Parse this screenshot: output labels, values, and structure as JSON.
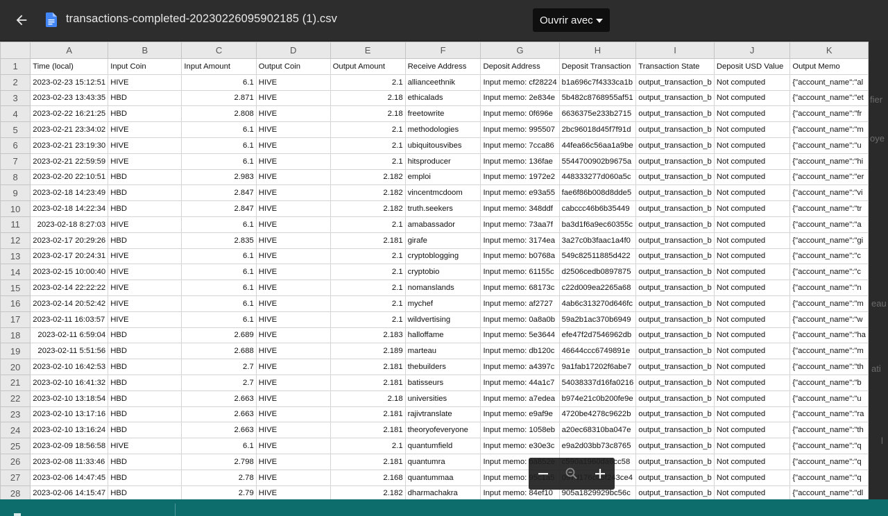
{
  "viewer": {
    "filename": "transactions-completed-20230226095902185 (1).csv",
    "open_with_label": "Ouvrir avec",
    "back_icon": "arrow-left-icon",
    "file_icon": "google-docs-icon"
  },
  "background_text": [
    "fier",
    "oye",
    "eau",
    "ati",
    "l"
  ],
  "sheet": {
    "columns": [
      "A",
      "B",
      "C",
      "D",
      "E",
      "F",
      "G",
      "H",
      "I",
      "J",
      "K"
    ],
    "headers": [
      "Time (local)",
      "Input Coin",
      "Input Amount",
      "Output Coin",
      "Output Amount",
      "Receive Address",
      "Deposit Address",
      "Deposit Transaction",
      "Transaction State",
      "Deposit USD Value",
      "Output Memo"
    ],
    "rows": [
      [
        "2023-02-23 15:12:51",
        "HIVE",
        "6.1",
        "HIVE",
        "2.1",
        "allianceethnik",
        "Input memo: cf28224",
        "b1a696c7f4333ca1b",
        "output_transaction_b",
        "Not computed",
        "{\"account_name\":\"al"
      ],
      [
        "2023-02-23 13:43:35",
        "HBD",
        "2.871",
        "HIVE",
        "2.18",
        "ethicalads",
        "Input memo: 2e834e",
        "5b482c8768955af51",
        "output_transaction_b",
        "Not computed",
        "{\"account_name\":\"et"
      ],
      [
        "2023-02-22 16:21:25",
        "HBD",
        "2.808",
        "HIVE",
        "2.18",
        "freetowrite",
        "Input memo: 0f696e",
        "6636375e233b2715",
        "output_transaction_b",
        "Not computed",
        "{\"account_name\":\"fr"
      ],
      [
        "2023-02-21 23:34:02",
        "HIVE",
        "6.1",
        "HIVE",
        "2.1",
        "methodologies",
        "Input memo: 995507",
        "2bc96018d45f7f91d",
        "output_transaction_b",
        "Not computed",
        "{\"account_name\":\"m"
      ],
      [
        "2023-02-21 23:19:30",
        "HIVE",
        "6.1",
        "HIVE",
        "2.1",
        "ubiquitousvibes",
        "Input memo: 7cca86",
        "44fea66c56aa1a9be",
        "output_transaction_b",
        "Not computed",
        "{\"account_name\":\"u"
      ],
      [
        "2023-02-21 22:59:59",
        "HIVE",
        "6.1",
        "HIVE",
        "2.1",
        "hitsproducer",
        "Input memo: 136fae",
        "5544700902b9675a",
        "output_transaction_b",
        "Not computed",
        "{\"account_name\":\"hi"
      ],
      [
        "2023-02-20 22:10:51",
        "HBD",
        "2.983",
        "HIVE",
        "2.182",
        "emploi",
        "Input memo: 1972e2",
        "448333277d060a5c",
        "output_transaction_b",
        "Not computed",
        "{\"account_name\":\"er"
      ],
      [
        "2023-02-18 14:23:49",
        "HBD",
        "2.847",
        "HIVE",
        "2.182",
        "vincentmcdoom",
        "Input memo: e93a55",
        "fae6f86b008d8dde5",
        "output_transaction_b",
        "Not computed",
        "{\"account_name\":\"vi"
      ],
      [
        "2023-02-18 14:22:34",
        "HBD",
        "2.847",
        "HIVE",
        "2.182",
        "truth.seekers",
        "Input memo: 348ddf",
        "cabccc46b6b35449",
        "output_transaction_b",
        "Not computed",
        "{\"account_name\":\"tr"
      ],
      [
        "2023-02-18 8:27:03",
        "HIVE",
        "6.1",
        "HIVE",
        "2.1",
        "amabassador",
        "Input memo: 73aa7f",
        "ba3d1f6a9ec60355c",
        "output_transaction_b",
        "Not computed",
        "{\"account_name\":\"a"
      ],
      [
        "2023-02-17 20:29:26",
        "HBD",
        "2.835",
        "HIVE",
        "2.181",
        "girafe",
        "Input memo: 3174ea",
        "3a27c0b3faac1a4f0",
        "output_transaction_b",
        "Not computed",
        "{\"account_name\":\"gi"
      ],
      [
        "2023-02-17 20:24:31",
        "HIVE",
        "6.1",
        "HIVE",
        "2.1",
        "cryptoblogging",
        "Input memo: b0768a",
        "549c82511885d422",
        "output_transaction_b",
        "Not computed",
        "{\"account_name\":\"c"
      ],
      [
        "2023-02-15 10:00:40",
        "HIVE",
        "6.1",
        "HIVE",
        "2.1",
        "cryptobio",
        "Input memo: 61155c",
        "d2506cedb0897875",
        "output_transaction_b",
        "Not computed",
        "{\"account_name\":\"c"
      ],
      [
        "2023-02-14 22:22:22",
        "HIVE",
        "6.1",
        "HIVE",
        "2.1",
        "nomanslands",
        "Input memo: 68173c",
        "c22d009ea2265a68",
        "output_transaction_b",
        "Not computed",
        "{\"account_name\":\"n"
      ],
      [
        "2023-02-14 20:52:42",
        "HIVE",
        "6.1",
        "HIVE",
        "2.1",
        "mychef",
        "Input memo: af2727",
        "4ab6c313270d646fc",
        "output_transaction_b",
        "Not computed",
        "{\"account_name\":\"m"
      ],
      [
        "2023-02-11 16:03:57",
        "HIVE",
        "6.1",
        "HIVE",
        "2.1",
        "wildvertising",
        "Input memo: 0a8a0b",
        "59a2b1ac370b6949",
        "output_transaction_b",
        "Not computed",
        "{\"account_name\":\"w"
      ],
      [
        "2023-02-11 6:59:04",
        "HBD",
        "2.689",
        "HIVE",
        "2.183",
        "halloffame",
        "Input memo: 5e3644",
        "efe47f2d7546962db",
        "output_transaction_b",
        "Not computed",
        "{\"account_name\":\"ha"
      ],
      [
        "2023-02-11 5:51:56",
        "HBD",
        "2.688",
        "HIVE",
        "2.189",
        "marteau",
        "Input memo: db120c",
        "46644ccc6749891e",
        "output_transaction_b",
        "Not computed",
        "{\"account_name\":\"m"
      ],
      [
        "2023-02-10 16:42:53",
        "HBD",
        "2.7",
        "HIVE",
        "2.181",
        "thebuilders",
        "Input memo: a4397c",
        "9a1fab17202f6abe7",
        "output_transaction_b",
        "Not computed",
        "{\"account_name\":\"th"
      ],
      [
        "2023-02-10 16:41:32",
        "HBD",
        "2.7",
        "HIVE",
        "2.181",
        "batisseurs",
        "Input memo: 44a1c7",
        "54038337d16fa0216",
        "output_transaction_b",
        "Not computed",
        "{\"account_name\":\"b"
      ],
      [
        "2023-02-10 13:18:54",
        "HBD",
        "2.663",
        "HIVE",
        "2.18",
        "universities",
        "Input memo: a7edea",
        "b974e21c0b200fe9e",
        "output_transaction_b",
        "Not computed",
        "{\"account_name\":\"u"
      ],
      [
        "2023-02-10 13:17:16",
        "HBD",
        "2.663",
        "HIVE",
        "2.181",
        "rajivtranslate",
        "Input memo: e9af9e",
        "4720be4278c9622b",
        "output_transaction_b",
        "Not computed",
        "{\"account_name\":\"ra"
      ],
      [
        "2023-02-10 13:16:24",
        "HBD",
        "2.663",
        "HIVE",
        "2.181",
        "theoryofeveryone",
        "Input memo: 1058eb",
        "a20ec68310ba047e",
        "output_transaction_b",
        "Not computed",
        "{\"account_name\":\"th"
      ],
      [
        "2023-02-09 18:56:58",
        "HIVE",
        "6.1",
        "HIVE",
        "2.1",
        "quantumfield",
        "Input memo: e30e3c",
        "e9a2d03bb73c8765",
        "output_transaction_b",
        "Not computed",
        "{\"account_name\":\"q"
      ],
      [
        "2023-02-08 11:33:46",
        "HBD",
        "2.798",
        "HIVE",
        "2.181",
        "quantumra",
        "Input memo: ba852e",
        "c590a1960da6cc58",
        "output_transaction_b",
        "Not computed",
        "{\"account_name\":\"q"
      ],
      [
        "2023-02-06 14:47:45",
        "HBD",
        "2.78",
        "HIVE",
        "2.168",
        "quantummaa",
        "Input memo: 95c1a5",
        "097d176c05f243ce4",
        "output_transaction_b",
        "Not computed",
        "{\"account_name\":\"q"
      ],
      [
        "2023-02-06 14:15:47",
        "HBD",
        "2.79",
        "HIVE",
        "2.182",
        "dharmachakra",
        "Input memo: 84ef10",
        "905a1829929bc56c",
        "output_transaction_b",
        "Not computed",
        "{\"account_name\":\"dl"
      ]
    ]
  },
  "zoom": {
    "out_icon": "minus-icon",
    "reset_icon": "magnifier-icon",
    "in_icon": "plus-icon"
  }
}
